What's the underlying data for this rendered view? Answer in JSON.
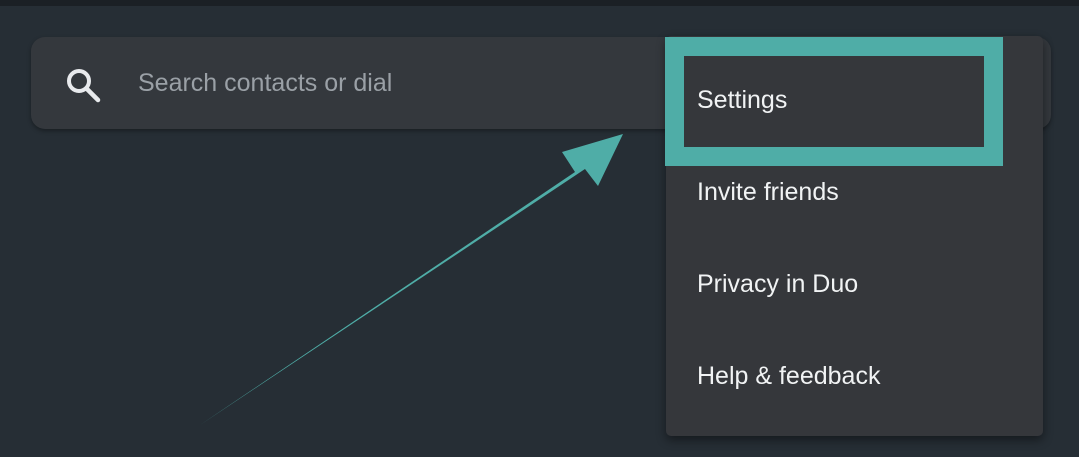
{
  "search": {
    "placeholder": "Search contacts or dial",
    "icon": "search-icon"
  },
  "menu": {
    "items": [
      {
        "label": "Settings",
        "highlighted": true
      },
      {
        "label": "Invite friends",
        "highlighted": false
      },
      {
        "label": "Privacy in Duo",
        "highlighted": false
      },
      {
        "label": "Help & feedback",
        "highlighted": false
      }
    ]
  },
  "colors": {
    "background": "#262e35",
    "search_bar": "#34383d",
    "menu": "#35373b",
    "highlight": "#4fada7",
    "text": "#f1f3f4",
    "placeholder": "#9aa0a6"
  }
}
